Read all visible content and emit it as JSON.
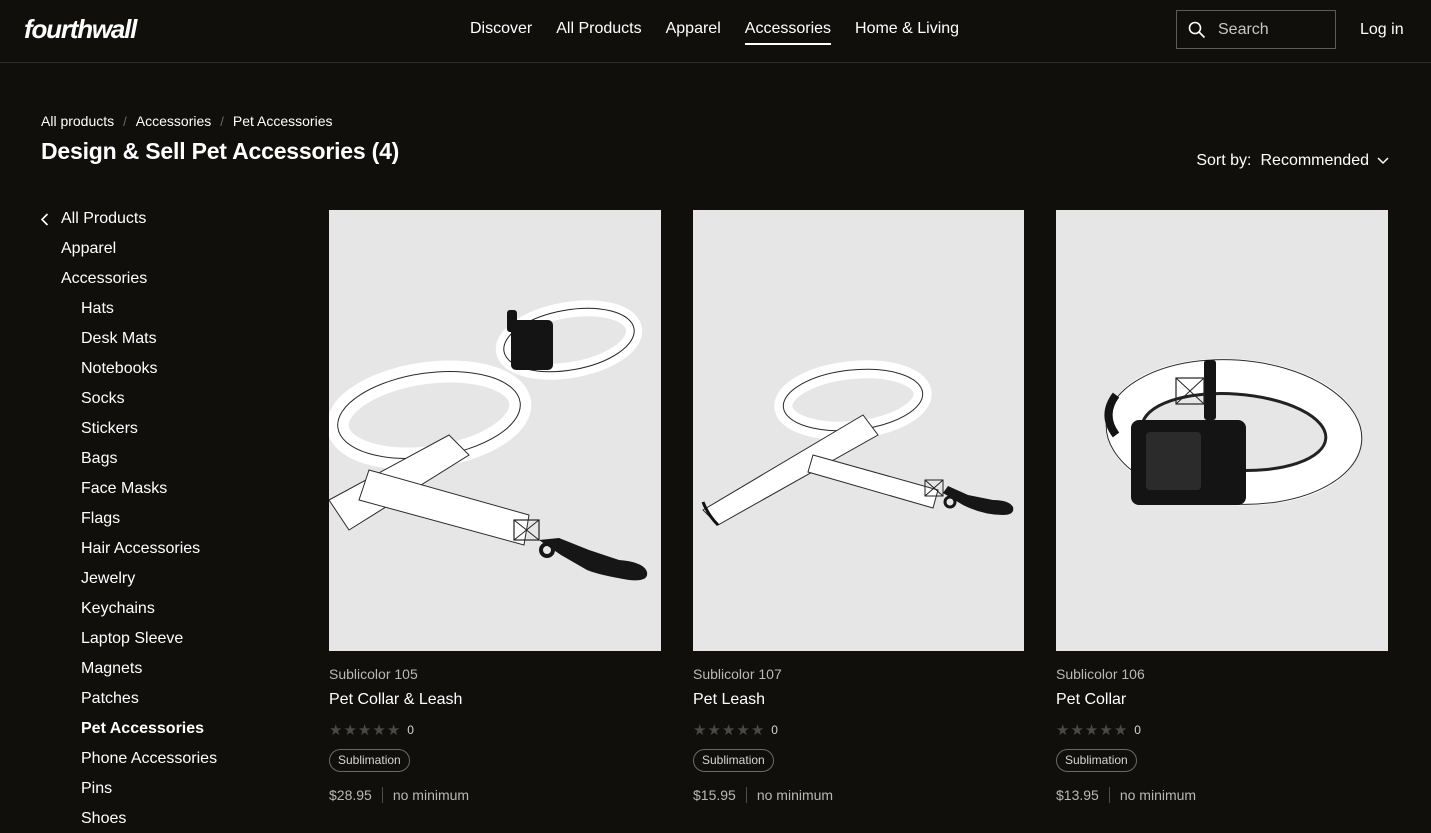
{
  "header": {
    "logo": "fourthwall",
    "nav": [
      {
        "label": "Discover"
      },
      {
        "label": "All Products"
      },
      {
        "label": "Apparel"
      },
      {
        "label": "Accessories"
      },
      {
        "label": "Home & Living"
      }
    ],
    "active_nav": "Accessories",
    "search_placeholder": "Search",
    "login": "Log in"
  },
  "breadcrumb": [
    "All products",
    "Accessories",
    "Pet Accessories"
  ],
  "page_title": "Design & Sell Pet Accessories (4)",
  "sort": {
    "label": "Sort by:",
    "value": "Recommended"
  },
  "sidebar": {
    "back_label": "All Products",
    "items": [
      "Apparel",
      "Accessories",
      "Hats",
      "Desk Mats",
      "Notebooks",
      "Socks",
      "Stickers",
      "Bags",
      "Face Masks",
      "Flags",
      "Hair Accessories",
      "Jewelry",
      "Keychains",
      "Laptop Sleeve",
      "Magnets",
      "Patches",
      "Pet Accessories",
      "Phone Accessories",
      "Pins",
      "Shoes"
    ],
    "active": "Pet Accessories"
  },
  "products": [
    {
      "brand": "Sublicolor 105",
      "name": "Pet Collar & Leash",
      "rating": 0,
      "rating_count": "0",
      "tag": "Sublimation",
      "price": "$28.95",
      "minimum": "no minimum"
    },
    {
      "brand": "Sublicolor 107",
      "name": "Pet Leash",
      "rating": 0,
      "rating_count": "0",
      "tag": "Sublimation",
      "price": "$15.95",
      "minimum": "no minimum"
    },
    {
      "brand": "Sublicolor 106",
      "name": "Pet Collar",
      "rating": 0,
      "rating_count": "0",
      "tag": "Sublimation",
      "price": "$13.95",
      "minimum": "no minimum"
    }
  ],
  "icons": {
    "search": "search-icon",
    "sort_chevron": "chevron-down-icon",
    "back": "chevron-left-icon",
    "star": "star-icon"
  },
  "colors": {
    "background": "#100f0c",
    "text": "#ffffff",
    "muted": "#b9b8b4",
    "product_bg": "#e6e6e6"
  }
}
